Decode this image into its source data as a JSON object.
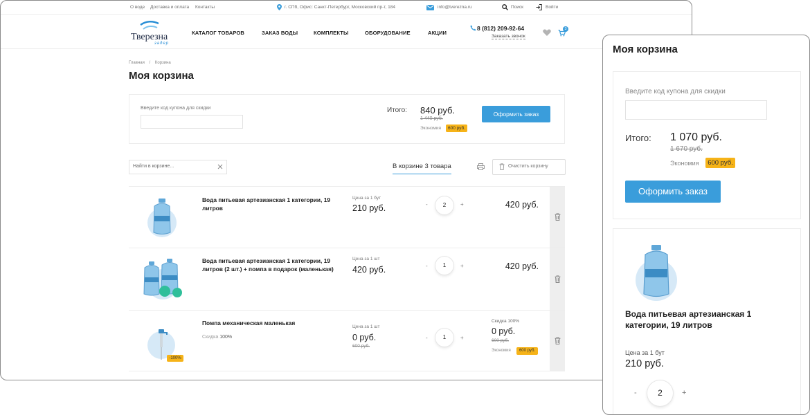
{
  "topbar": {
    "links": [
      "О воде",
      "Доставка и оплата",
      "Контакты"
    ],
    "address": "г. СПб, Офис: Санкт-Петербург, Московский пр-т, 184",
    "email": "info@tverezna.ru",
    "search": "Поиск",
    "login": "Войти"
  },
  "header": {
    "logo": "Тверезна",
    "logo_sub": "задер",
    "nav": [
      "КАТАЛОГ ТОВАРОВ",
      "ЗАКАЗ ВОДЫ",
      "КОМПЛЕКТЫ",
      "ОБОРУДОВАНИЕ",
      "АКЦИИ"
    ],
    "phone": "8 (812) 209-92-64",
    "callback": "Заказать звонок",
    "cart_count": "3"
  },
  "breadcrumbs": [
    "Главная",
    "/",
    "Корзина"
  ],
  "page_title": "Моя корзина",
  "summary": {
    "coupon_label": "Введите код купона для скидки",
    "total_label": "Итого:",
    "total": "840 руб.",
    "total_old": "1 440 руб.",
    "saving_label": "Экономия",
    "saving": "600 руб.",
    "checkout": "Оформить заказ"
  },
  "cart_tools": {
    "search_placeholder": "Найти в корзине...",
    "in_cart": "В корзине 3 товара",
    "clear": "Очистить корзину"
  },
  "items": [
    {
      "name": "Вода питьевая артезианская 1 категории, 19 литров",
      "unit_label": "Цена за 1 бут",
      "unit_price": "210 руб.",
      "qty": "2",
      "sum": "420 руб."
    },
    {
      "name": "Вода питьевая артезианская 1 категории, 19 литров (2 шт.) + помпа в подарок (маленькая)",
      "unit_label": "Цена за 1 шт",
      "unit_price": "420 руб.",
      "qty": "1",
      "sum": "420 руб."
    },
    {
      "name": "Помпа механическая маленькая",
      "discount_label": "Скидка",
      "discount_value": "100%",
      "unit_label": "Цена за 1 шт",
      "unit_price": "0 руб.",
      "unit_old": "600 руб.",
      "qty": "1",
      "sum_discount": "Скидка 100%",
      "sum": "0 руб.",
      "sum_old": "600 руб.",
      "saving_label": "Экономия",
      "saving": "600 руб.",
      "image_badge": "-100%"
    }
  ],
  "qty_minus": "-",
  "qty_plus": "+",
  "mobile": {
    "title": "Моя корзина",
    "coupon_label": "Введите код купона для скидки",
    "total_label": "Итого:",
    "total": "1 070 руб.",
    "total_old": "1 670 руб.",
    "saving_label": "Экономия",
    "saving": "600 руб.",
    "checkout": "Оформить заказ",
    "item_name": "Вода питьевая артезианская 1 категории, 19 литров",
    "unit_label": "Цена за 1 бут",
    "unit_price": "210 руб.",
    "qty": "2"
  },
  "colors": {
    "accent": "#3a9ddb",
    "badge": "#f6b318"
  }
}
